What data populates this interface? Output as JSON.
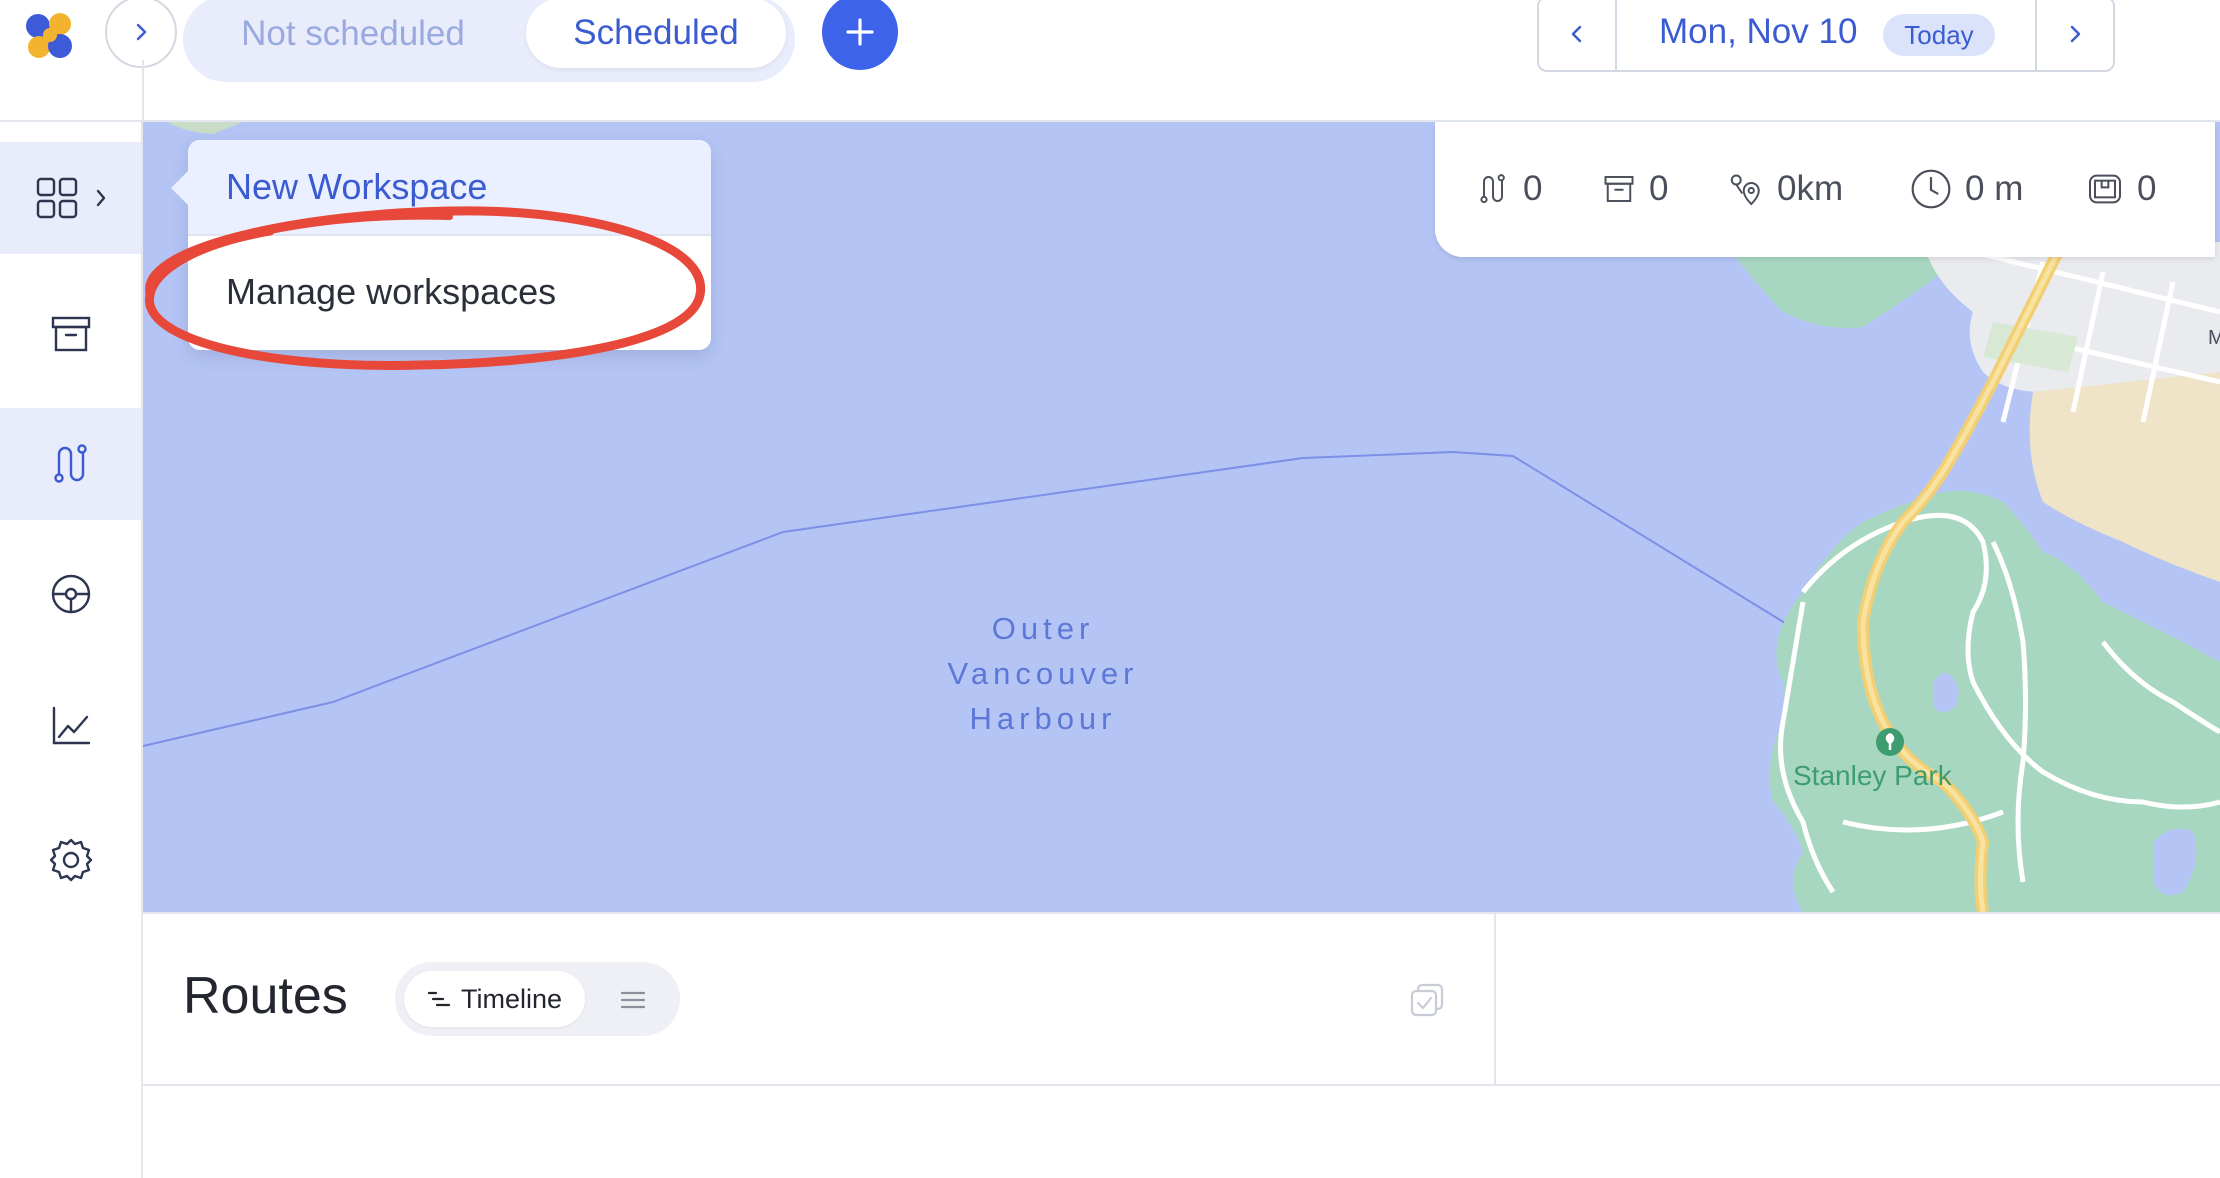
{
  "header": {
    "tabs": [
      {
        "label": "Not scheduled",
        "active": false
      },
      {
        "label": "Scheduled",
        "active": true
      }
    ],
    "date_label": "Mon, Nov 10",
    "today_label": "Today"
  },
  "sidebar": {
    "items": [
      {
        "name": "workspaces",
        "icon": "grid-icon",
        "active": true
      },
      {
        "name": "orders",
        "icon": "archive-box-icon",
        "active": false
      },
      {
        "name": "routes",
        "icon": "route-icon",
        "active": true
      },
      {
        "name": "drivers",
        "icon": "steering-wheel-icon",
        "active": false
      },
      {
        "name": "analytics",
        "icon": "chart-icon",
        "active": false
      },
      {
        "name": "settings",
        "icon": "gear-icon",
        "active": false
      }
    ]
  },
  "dropdown": {
    "items": [
      {
        "label": "New Workspace"
      },
      {
        "label": "Manage workspaces"
      }
    ]
  },
  "map": {
    "water_label_lines": [
      "Outer",
      "Vancouver",
      "Harbour"
    ],
    "park_label": "Stanley Park",
    "edge_label": "M"
  },
  "stats": {
    "routes": "0",
    "stops": "0",
    "distance": "0km",
    "duration": "0 m",
    "load": "0"
  },
  "routes_panel": {
    "title": "Routes",
    "view_timeline_label": "Timeline"
  },
  "colors": {
    "accent": "#3d63ea",
    "water": "#b4c5f5",
    "park": "#a7d7c0",
    "annotation_red": "#e8483a"
  }
}
